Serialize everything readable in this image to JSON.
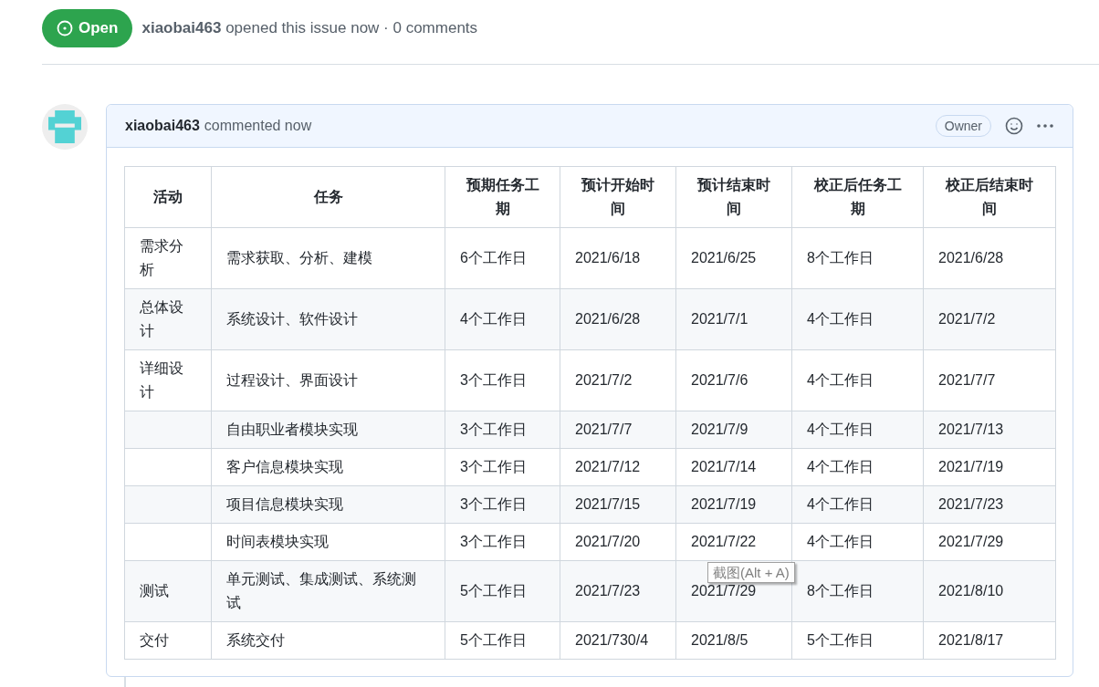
{
  "issue_header": {
    "state_badge": "Open",
    "author": "xiaobai463",
    "summary": "opened this issue now · 0 comments"
  },
  "comment": {
    "author": "xiaobai463",
    "time": "commented now",
    "role_badge": "Owner",
    "table": {
      "columns": [
        "活动",
        "任务",
        "预期任务工期",
        "预计开始时间",
        "预计结束时间",
        "校正后任务工期",
        "校正后结束时间"
      ],
      "rows": [
        [
          "需求分析",
          "需求获取、分析、建模",
          "6个工作日",
          "2021/6/18",
          "2021/6/25",
          "8个工作日",
          "2021/6/28"
        ],
        [
          "总体设计",
          "系统设计、软件设计",
          "4个工作日",
          "2021/6/28",
          "2021/7/1",
          "4个工作日",
          "2021/7/2"
        ],
        [
          "详细设计",
          "过程设计、界面设计",
          "3个工作日",
          "2021/7/2",
          "2021/7/6",
          "4个工作日",
          "2021/7/7"
        ],
        [
          "",
          "自由职业者模块实现",
          "3个工作日",
          "2021/7/7",
          "2021/7/9",
          "4个工作日",
          "2021/7/13"
        ],
        [
          "",
          "客户信息模块实现",
          "3个工作日",
          "2021/7/12",
          "2021/7/14",
          "4个工作日",
          "2021/7/19"
        ],
        [
          "",
          "项目信息模块实现",
          "3个工作日",
          "2021/7/15",
          "2021/7/19",
          "4个工作日",
          "2021/7/23"
        ],
        [
          "",
          "时间表模块实现",
          "3个工作日",
          "2021/7/20",
          "2021/7/22",
          "4个工作日",
          "2021/7/29"
        ],
        [
          "测试",
          "单元测试、集成测试、系统测试",
          "5个工作日",
          "2021/7/23",
          "2021/7/29",
          "8个工作日",
          "2021/8/10"
        ],
        [
          "交付",
          "系统交付",
          "5个工作日",
          "2021/730/4",
          "2021/8/5",
          "5个工作日",
          "2021/8/17"
        ]
      ]
    },
    "tooltip": {
      "text": "截图(Alt + A)"
    }
  }
}
